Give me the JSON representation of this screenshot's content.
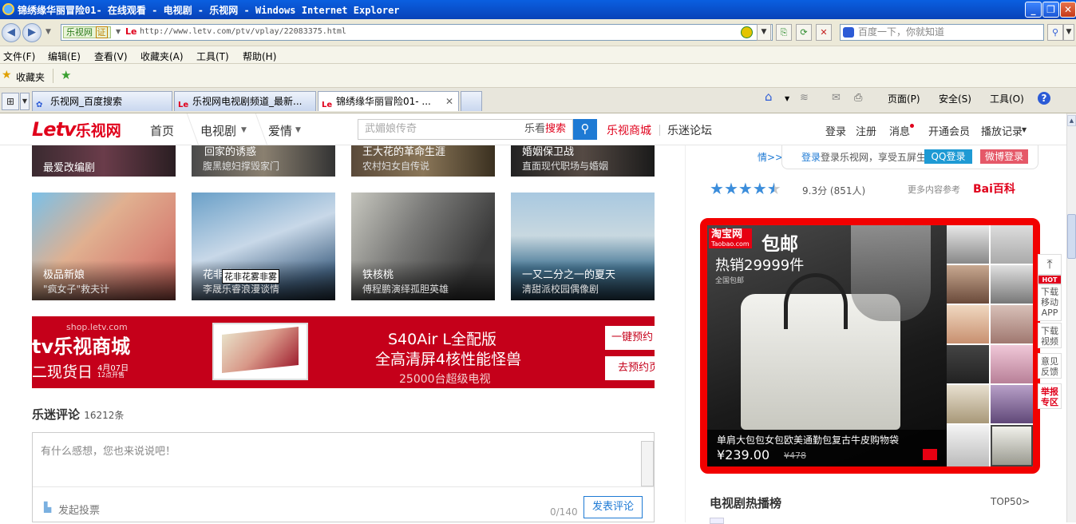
{
  "window": {
    "title": "锦绣缘华丽冒险01- 在线观看 - 电视剧 - 乐视网 - Windows Internet Explorer",
    "min": "_",
    "restore": "❐",
    "close": "✕"
  },
  "address": {
    "site_badge": "乐视网",
    "cert": "证",
    "favicon_text": "Le",
    "url": "http://www.letv.com/ptv/vplay/22083375.html",
    "search_placeholder": "百度一下，你就知道"
  },
  "menu": [
    "文件(F)",
    "编辑(E)",
    "查看(V)",
    "收藏夹(A)",
    "工具(T)",
    "帮助(H)"
  ],
  "favorites": {
    "label": "收藏夹"
  },
  "tabs": [
    {
      "label": "乐视网_百度搜索"
    },
    {
      "label": "乐视网电视剧频道_最新..."
    },
    {
      "label": "锦绣缘华丽冒险01- ..."
    }
  ],
  "toolbar_right": {
    "page": "页面(P)",
    "safety": "安全(S)",
    "tools": "工具(O)"
  },
  "site": {
    "logo": "Letv",
    "logo_cn": "乐视网",
    "nav": [
      "首页",
      "电视剧",
      "爱情"
    ],
    "search_placeholder": "武媚娘传奇",
    "search_kan": "乐看",
    "search_sou": "搜索",
    "shop_link": "乐视商城",
    "forum_link": "乐迷论坛",
    "right": [
      "登录",
      "注册",
      "消息",
      "开通会员",
      "播放记录"
    ]
  },
  "row_top": [
    {
      "title": "最爱改编剧"
    },
    {
      "title": "回家的诱惑",
      "sub": "腹黑媳妇撑毁家门"
    },
    {
      "title": "王大花的革命生涯",
      "sub": "农村妇女自传说"
    },
    {
      "title": "婚姻保卫战",
      "sub": "直面现代职场与婚姻"
    }
  ],
  "row_main": [
    {
      "title": "极品新娘",
      "sub": "\"疯女子\"救夫计"
    },
    {
      "title": "花非花雾非雾",
      "sub": "李晟乐睿浪漫谈情",
      "tooltip": "花非花雾非雾"
    },
    {
      "title": "铁核桃",
      "sub": "傅程鹏演绎孤胆英雄"
    },
    {
      "title": "一又二分之一的夏天",
      "sub": "清甜派校园偶像剧"
    }
  ],
  "banner": {
    "domain": "shop.letv.com",
    "brand": "tv乐视商城",
    "date_line": "二现货日",
    "date": "4月07日",
    "date_time": "12点开售",
    "line1": "S40Air L全配版",
    "line2": "全高清屏4核性能怪兽",
    "line3": "25000台超级电视",
    "btn1": "一键预约",
    "btn2": "去预约页"
  },
  "comments": {
    "title": "乐迷评论",
    "count": "16212条",
    "placeholder": "有什么感想，您也来说说吧！",
    "vote": "发起投票",
    "counter": "0/140",
    "submit": "发表评论"
  },
  "right": {
    "login_prefix": "情>>",
    "login_text": "登录乐视网，享受五屏生活",
    "qq": "QQ登录",
    "weibo": "微博登录",
    "score": "9.3分 (851人)",
    "rating_stars": 4.5,
    "more": "更多内容参考",
    "baidu": "Bai百科",
    "ad": {
      "taobao": "淘宝网",
      "taobao_en": "Taobao.com",
      "free_ship": "包邮",
      "hot": "热销29999件",
      "nationwide": "全国包邮",
      "product": "单肩大包包女包欧美通勤包复古牛皮购物袋",
      "price": "¥239.00",
      "orig_price": "¥478"
    },
    "hot_title": "电视剧热播榜",
    "top50": "TOP50>"
  },
  "side_tools": [
    "HOT",
    "下载移动APP",
    "下载视频",
    "意见反馈",
    "举报专区"
  ],
  "colors": {
    "brand": "#e0001b",
    "blue": "#1e7ad4",
    "ad_border": "#f20000"
  }
}
